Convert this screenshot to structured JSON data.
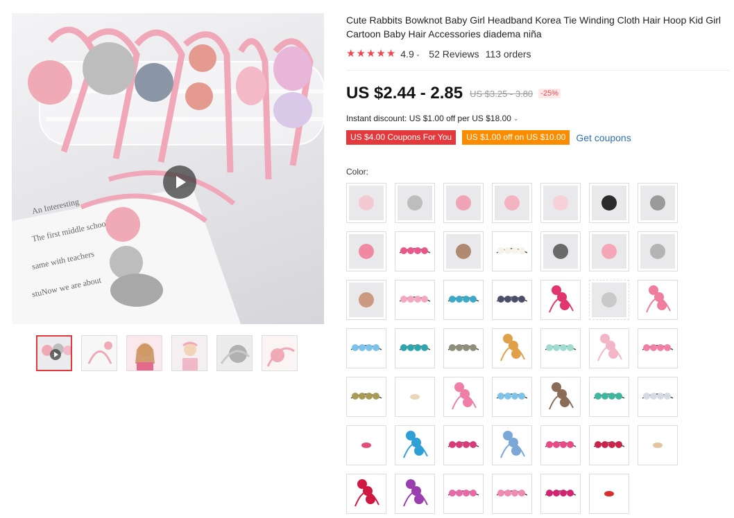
{
  "product": {
    "title": "Cute Rabbits Bowknot Baby Girl Headband Korea Tie Winding Cloth Hair Hoop Kid Girl Cartoon Baby Hair Accessories diadema niña"
  },
  "gallery": {
    "main_image_icon": "headband-product-photo",
    "play_icon": "play-icon",
    "main_image_text": "An Interesting spe\nThe first middle sc cial girl same with teachers called stuNow we are about world and friends.",
    "thumbnails": [
      {
        "icon": "video-thumbnail",
        "active": true
      },
      {
        "icon": "headband-thumbnail"
      },
      {
        "icon": "girl-model-thumbnail"
      },
      {
        "icon": "girl-model-thumbnail"
      },
      {
        "icon": "gray-bow-thumbnail"
      },
      {
        "icon": "pink-flower-thumbnail"
      }
    ]
  },
  "rating": {
    "stars": 5,
    "value": "4.9",
    "reviews": "52 Reviews",
    "orders": "113 orders"
  },
  "price": {
    "current": "US $2.44 - 2.85",
    "original": "US $3.25 - 3.80",
    "discount": "-25%"
  },
  "instant_discount": "Instant discount: US $1.00 off per US $18.00",
  "coupons": {
    "coupon1": "US $4.00 Coupons For You",
    "coupon2": "US $1.00 off on US $10.00",
    "get_coupons": "Get coupons"
  },
  "color": {
    "label": "Color:",
    "selected": ""
  },
  "colors": {
    "accent_red": "#e4393c",
    "star_red": "#f0464f",
    "coupon_orange": "#fb8c00",
    "link_blue": "#2f6fb0"
  },
  "swatches": [
    {
      "color": "#f2c9d0",
      "style": "photo"
    },
    {
      "color": "#bdbdbd",
      "style": "photo"
    },
    {
      "color": "#f0a3b4",
      "style": "photo"
    },
    {
      "color": "#f3b3c0",
      "style": "photo"
    },
    {
      "color": "#f5d0d8",
      "style": "photo"
    },
    {
      "color": "#2b2b2b",
      "style": "photo"
    },
    {
      "color": "#9a9a9a",
      "style": "photo"
    },
    {
      "color": "#f08aa2",
      "style": "photo"
    },
    {
      "color": "#e8588a",
      "style": "band"
    },
    {
      "color": "#b08a70",
      "style": "photo"
    },
    {
      "color": "#f7f2ea",
      "style": "band"
    },
    {
      "color": "#6a6a6a",
      "style": "photo"
    },
    {
      "color": "#f5a7b8",
      "style": "photo"
    },
    {
      "color": "#b4b4b4",
      "style": "photo"
    },
    {
      "color": "#c99a80",
      "style": "photo"
    },
    {
      "color": "#f3a8c0",
      "style": "band"
    },
    {
      "color": "#3ea8c8",
      "style": "band"
    },
    {
      "color": "#4a4f6a",
      "style": "band"
    },
    {
      "color": "#e0356f",
      "style": "hearts"
    },
    {
      "color": "#c9c9c9",
      "style": "photo"
    },
    {
      "color": "#ee7d9e",
      "style": "hearts"
    },
    {
      "color": "#7cc2ea",
      "style": "band"
    },
    {
      "color": "#2fa6ae",
      "style": "band"
    },
    {
      "color": "#8e8e7a",
      "style": "band"
    },
    {
      "color": "#e0a04a",
      "style": "hearts"
    },
    {
      "color": "#9fdcd0",
      "style": "band"
    },
    {
      "color": "#f4b6c6",
      "style": "hearts"
    },
    {
      "color": "#f27fa6",
      "style": "band"
    },
    {
      "color": "#a99a55",
      "style": "band"
    },
    {
      "color": "#e9d6b8",
      "style": "small"
    },
    {
      "color": "#ef7fa6",
      "style": "hearts"
    },
    {
      "color": "#7ec4e8",
      "style": "band"
    },
    {
      "color": "#8a6c58",
      "style": "hearts"
    },
    {
      "color": "#3fb6a0",
      "style": "band"
    },
    {
      "color": "#d6dae6",
      "style": "band"
    },
    {
      "color": "#e2507a",
      "style": "small"
    },
    {
      "color": "#2ea0d8",
      "style": "hearts"
    },
    {
      "color": "#d83a7a",
      "style": "band"
    },
    {
      "color": "#7aa6d8",
      "style": "hearts"
    },
    {
      "color": "#e84a86",
      "style": "band"
    },
    {
      "color": "#c8244a",
      "style": "band"
    },
    {
      "color": "#e4c4a0",
      "style": "small"
    },
    {
      "color": "#d01840",
      "style": "hearts"
    },
    {
      "color": "#9b3fb0",
      "style": "hearts"
    },
    {
      "color": "#e56aa6",
      "style": "band"
    },
    {
      "color": "#f08ab0",
      "style": "band"
    },
    {
      "color": "#d22470",
      "style": "band"
    },
    {
      "color": "#d8302e",
      "style": "small"
    }
  ]
}
